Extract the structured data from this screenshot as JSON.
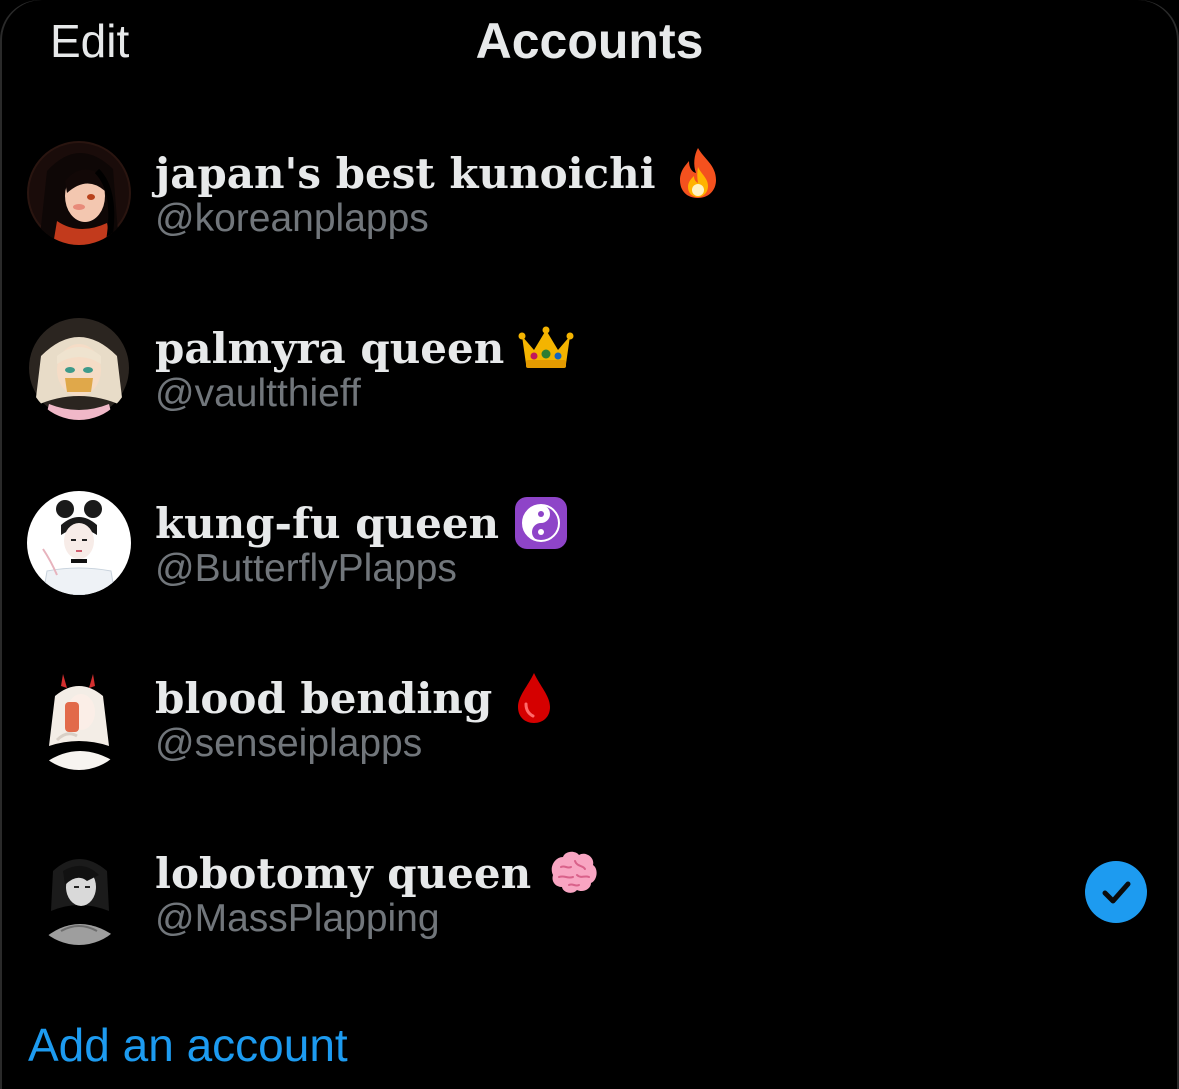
{
  "header": {
    "edit_label": "Edit",
    "title": "Accounts"
  },
  "accounts": [
    {
      "name": "japan's best kunoichi",
      "emoji": "fire-icon",
      "handle": "@koreanplapps",
      "selected": false
    },
    {
      "name": "palmyra queen",
      "emoji": "crown-icon",
      "handle": "@vaultthieff",
      "selected": false
    },
    {
      "name": "kung-fu queen",
      "emoji": "yin-yang-icon",
      "handle": "@ButterflyPlapps",
      "selected": false
    },
    {
      "name": "blood bending",
      "emoji": "drop-of-blood-icon",
      "handle": "@senseiplapps",
      "selected": false
    },
    {
      "name": "lobotomy queen",
      "emoji": "brain-icon",
      "handle": "@MassPlapping",
      "selected": true
    }
  ],
  "footer": {
    "add_account_label": "Add an account"
  },
  "colors": {
    "background": "#000000",
    "primary_text": "#e7e9ea",
    "secondary_text": "#71767b",
    "accent": "#1d9bf0"
  }
}
